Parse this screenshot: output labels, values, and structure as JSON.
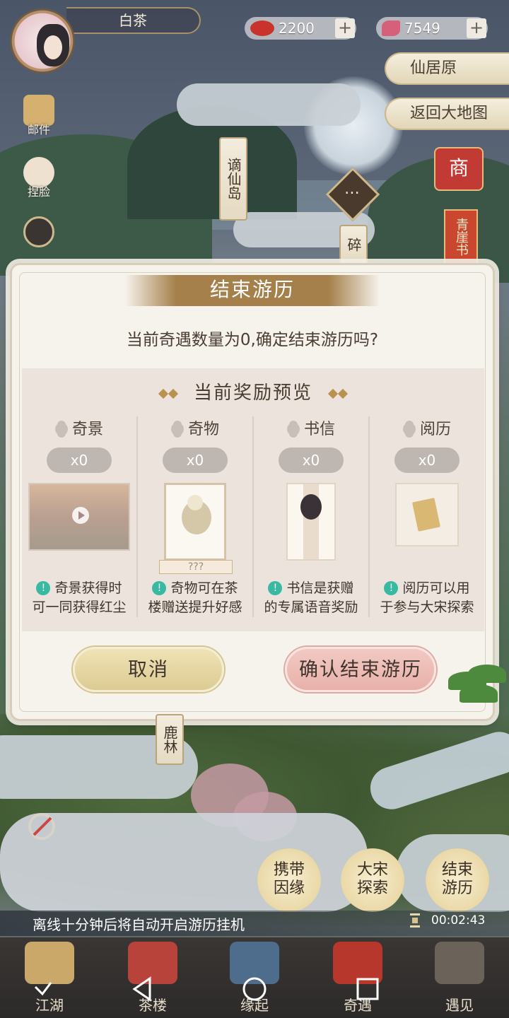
{
  "player": {
    "name": "白茶"
  },
  "resources": [
    {
      "icon": "red-bean-icon",
      "value": "2200",
      "color": "#c8342c"
    },
    {
      "icon": "pink-butterfly-icon",
      "value": "7549",
      "color": "#d6607a"
    }
  ],
  "location_buttons": {
    "current_area": "仙居原",
    "return_map": "返回大地图"
  },
  "side_menu": {
    "mail": "邮件",
    "face": "捏脸"
  },
  "map_labels": {
    "isle": "谪仙岛",
    "partial": "碎",
    "forest": "鹿林"
  },
  "shop": {
    "label": "商",
    "book": "青崖书"
  },
  "dialog": {
    "title": "结束游历",
    "question": "当前奇遇数量为0,确定结束游历吗?",
    "reward_title": "当前奖励预览",
    "rewards": [
      {
        "name": "奇景",
        "count": "x0",
        "desc_line1": "奇景获得时",
        "desc_line2": "可一同获得红尘"
      },
      {
        "name": "奇物",
        "count": "x0",
        "desc_line1": "奇物可在茶",
        "desc_line2": "楼赠送提升好感",
        "item_caption": "???"
      },
      {
        "name": "书信",
        "count": "x0",
        "desc_line1": "书信是获赠",
        "desc_line2": "的专属语音奖励"
      },
      {
        "name": "阅历",
        "count": "x0",
        "desc_line1": "阅历可以用",
        "desc_line2": "于参与大宋探索"
      }
    ],
    "cancel": "取消",
    "confirm": "确认结束游历"
  },
  "action_buttons": {
    "carry": [
      "携带",
      "因缘"
    ],
    "explore": [
      "大宋",
      "探索"
    ],
    "end": [
      "结束",
      "游历"
    ]
  },
  "offline_notice": "离线十分钟后将自动开启游历挂机",
  "timer": "00:02:43",
  "bottom_nav": [
    "江湖",
    "茶楼",
    "缘起",
    "奇遇",
    "遇见"
  ]
}
